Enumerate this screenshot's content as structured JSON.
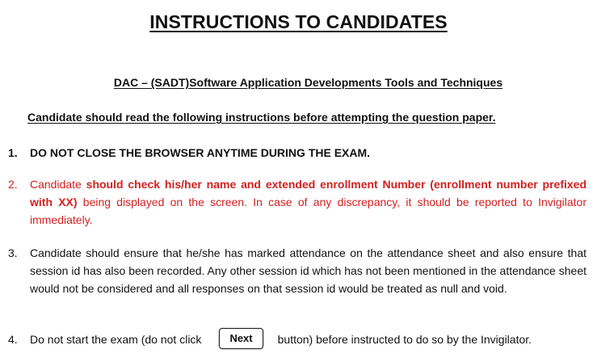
{
  "title": "INSTRUCTIONS TO CANDIDATES",
  "course": "DAC – (SADT)Software Application Developments Tools and Techniques",
  "subheading": "Candidate should read the following instructions before attempting the question paper.",
  "instructions": [
    {
      "number": "1.",
      "text": "DO NOT CLOSE THE BROWSER ANYTIME DURING THE EXAM."
    },
    {
      "number": "2.",
      "lead": "Candidate ",
      "bold": "should check his/her name and extended enrollment Number (enrollment number prefixed with XX)",
      "tail": " being displayed on the screen. In case of any discrepancy, it should be reported to Invigilator immediately."
    },
    {
      "number": "3.",
      "text": "Candidate should ensure that he/she has marked attendance on the attendance sheet and also ensure that session id has also been recorded. Any other session id which has not been mentioned in the attendance sheet would not be considered and all responses on that session id would be treated as null and void."
    },
    {
      "number": "4.",
      "before": "Do not start the exam (do not click",
      "button_label": "Next",
      "after": "button) before instructed to do so by the Invigilator."
    }
  ],
  "colors": {
    "text": "#111111",
    "highlight": "#d32020",
    "background": "#ffffff"
  }
}
